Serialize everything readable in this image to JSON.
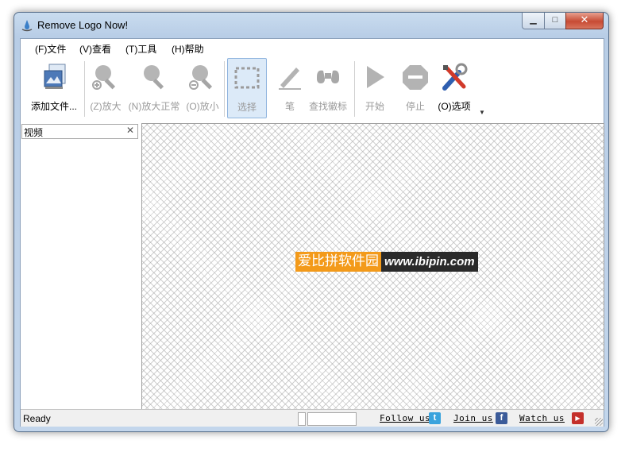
{
  "window": {
    "title": "Remove Logo Now!",
    "controls": {
      "minimize": "▁",
      "maximize": "□",
      "close": "✕"
    }
  },
  "menu": {
    "items": [
      {
        "label": "(F)文件"
      },
      {
        "label": "(V)查看"
      },
      {
        "label": "(T)工具"
      },
      {
        "label": "(H)帮助"
      }
    ]
  },
  "toolbar": {
    "items": [
      {
        "label": "添加文件...",
        "icon": "add-file-icon",
        "enabled": true
      },
      {
        "label": "(Z)放大",
        "icon": "zoom-in-icon",
        "enabled": false
      },
      {
        "label": "(N)放大正常",
        "icon": "zoom-normal-icon",
        "enabled": false
      },
      {
        "label": "(O)放小",
        "icon": "zoom-out-icon",
        "enabled": false
      },
      {
        "label": "选择",
        "icon": "select-rect-icon",
        "enabled": false,
        "selected": true
      },
      {
        "label": "笔",
        "icon": "pen-icon",
        "enabled": false
      },
      {
        "label": "查找徽标",
        "icon": "binoculars-icon",
        "enabled": false
      },
      {
        "label": "开始",
        "icon": "play-icon",
        "enabled": false
      },
      {
        "label": "停止",
        "icon": "stop-icon",
        "enabled": false
      },
      {
        "label": "(O)选项",
        "icon": "options-tools-icon",
        "enabled": true
      }
    ],
    "overflow_glyph": "▼"
  },
  "panel": {
    "title": "视频",
    "close_glyph": "✕"
  },
  "watermark": {
    "cn": "爱比拼软件园",
    "url": "www.ibipin.com"
  },
  "status": {
    "text": "Ready",
    "links": [
      {
        "label": "Follow us",
        "icon": "twitter-icon",
        "glyph": "t"
      },
      {
        "label": "Join us",
        "icon": "facebook-icon",
        "glyph": "f"
      },
      {
        "label": "Watch us",
        "icon": "youtube-icon",
        "glyph": "▶"
      }
    ]
  },
  "colors": {
    "accent_blue": "#4a90d9",
    "watermark_orange": "#f39a1a",
    "disabled_gray": "#9a9a9a",
    "close_red": "#c74b34"
  }
}
